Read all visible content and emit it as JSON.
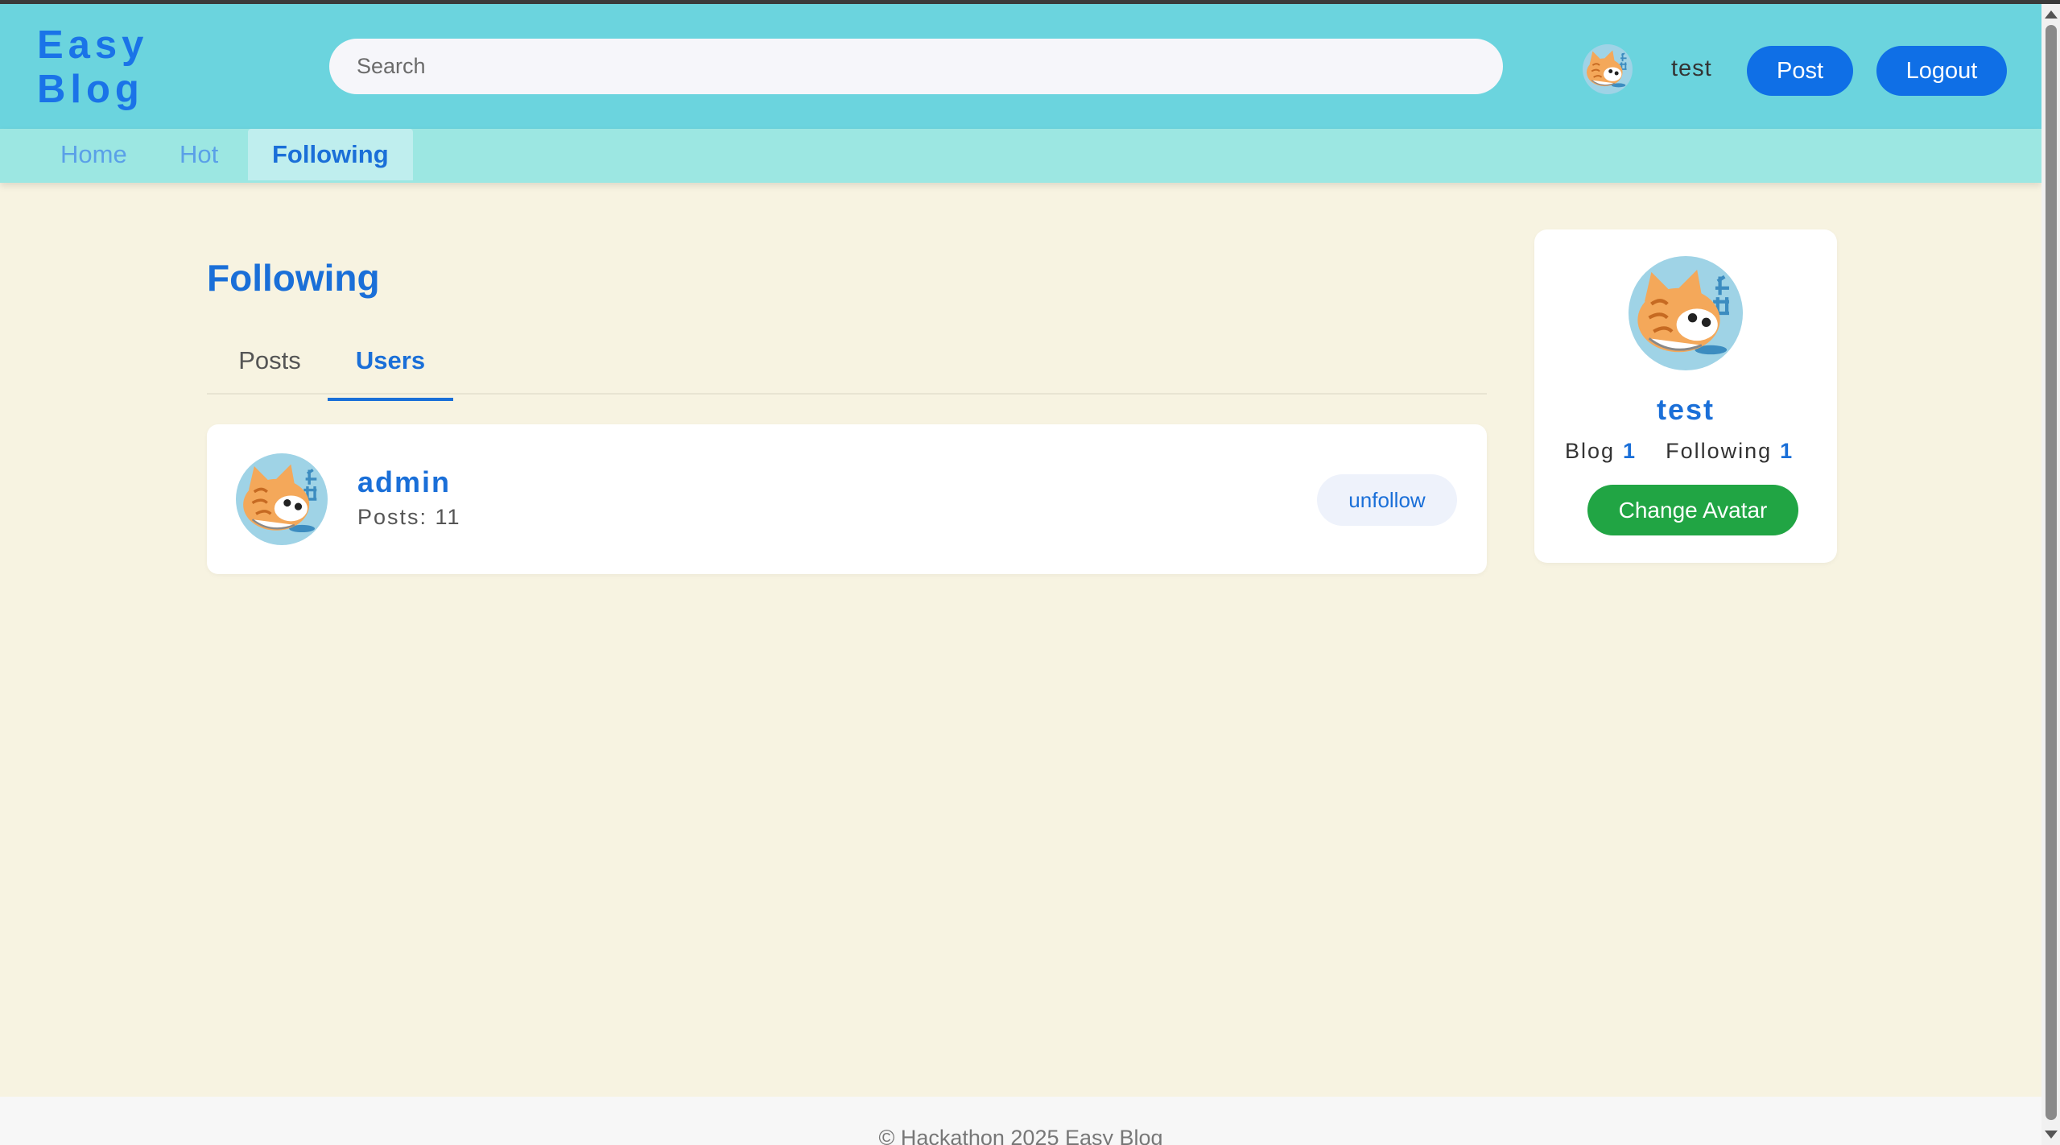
{
  "app": {
    "logo_line1": "Easy",
    "logo_line2": "Blog"
  },
  "header": {
    "search_placeholder": "Search",
    "username": "test",
    "avatar_icon": "cat-avatar-icon",
    "post_label": "Post",
    "logout_label": "Logout"
  },
  "nav": {
    "items": [
      {
        "label": "Home",
        "active": false
      },
      {
        "label": "Hot",
        "active": false
      },
      {
        "label": "Following",
        "active": true
      }
    ]
  },
  "main": {
    "title": "Following",
    "tabs": [
      {
        "label": "Posts",
        "active": false
      },
      {
        "label": "Users",
        "active": true
      }
    ],
    "users": [
      {
        "name": "admin",
        "posts_text": "Posts: 11",
        "action_label": "unfollow"
      }
    ]
  },
  "profile": {
    "name": "test",
    "blog_label": "Blog",
    "blog_count": "1",
    "following_label": "Following",
    "following_count": "1",
    "change_avatar_label": "Change Avatar"
  },
  "footer": {
    "text": "© Hackathon 2025 Easy Blog"
  },
  "colors": {
    "header_bg": "#6bd4de",
    "nav_bg": "#9ce7e2",
    "page_bg": "#f7f3e1",
    "accent": "#1a6fd8",
    "primary_button": "#0f6fe6",
    "success_button": "#21a544"
  }
}
